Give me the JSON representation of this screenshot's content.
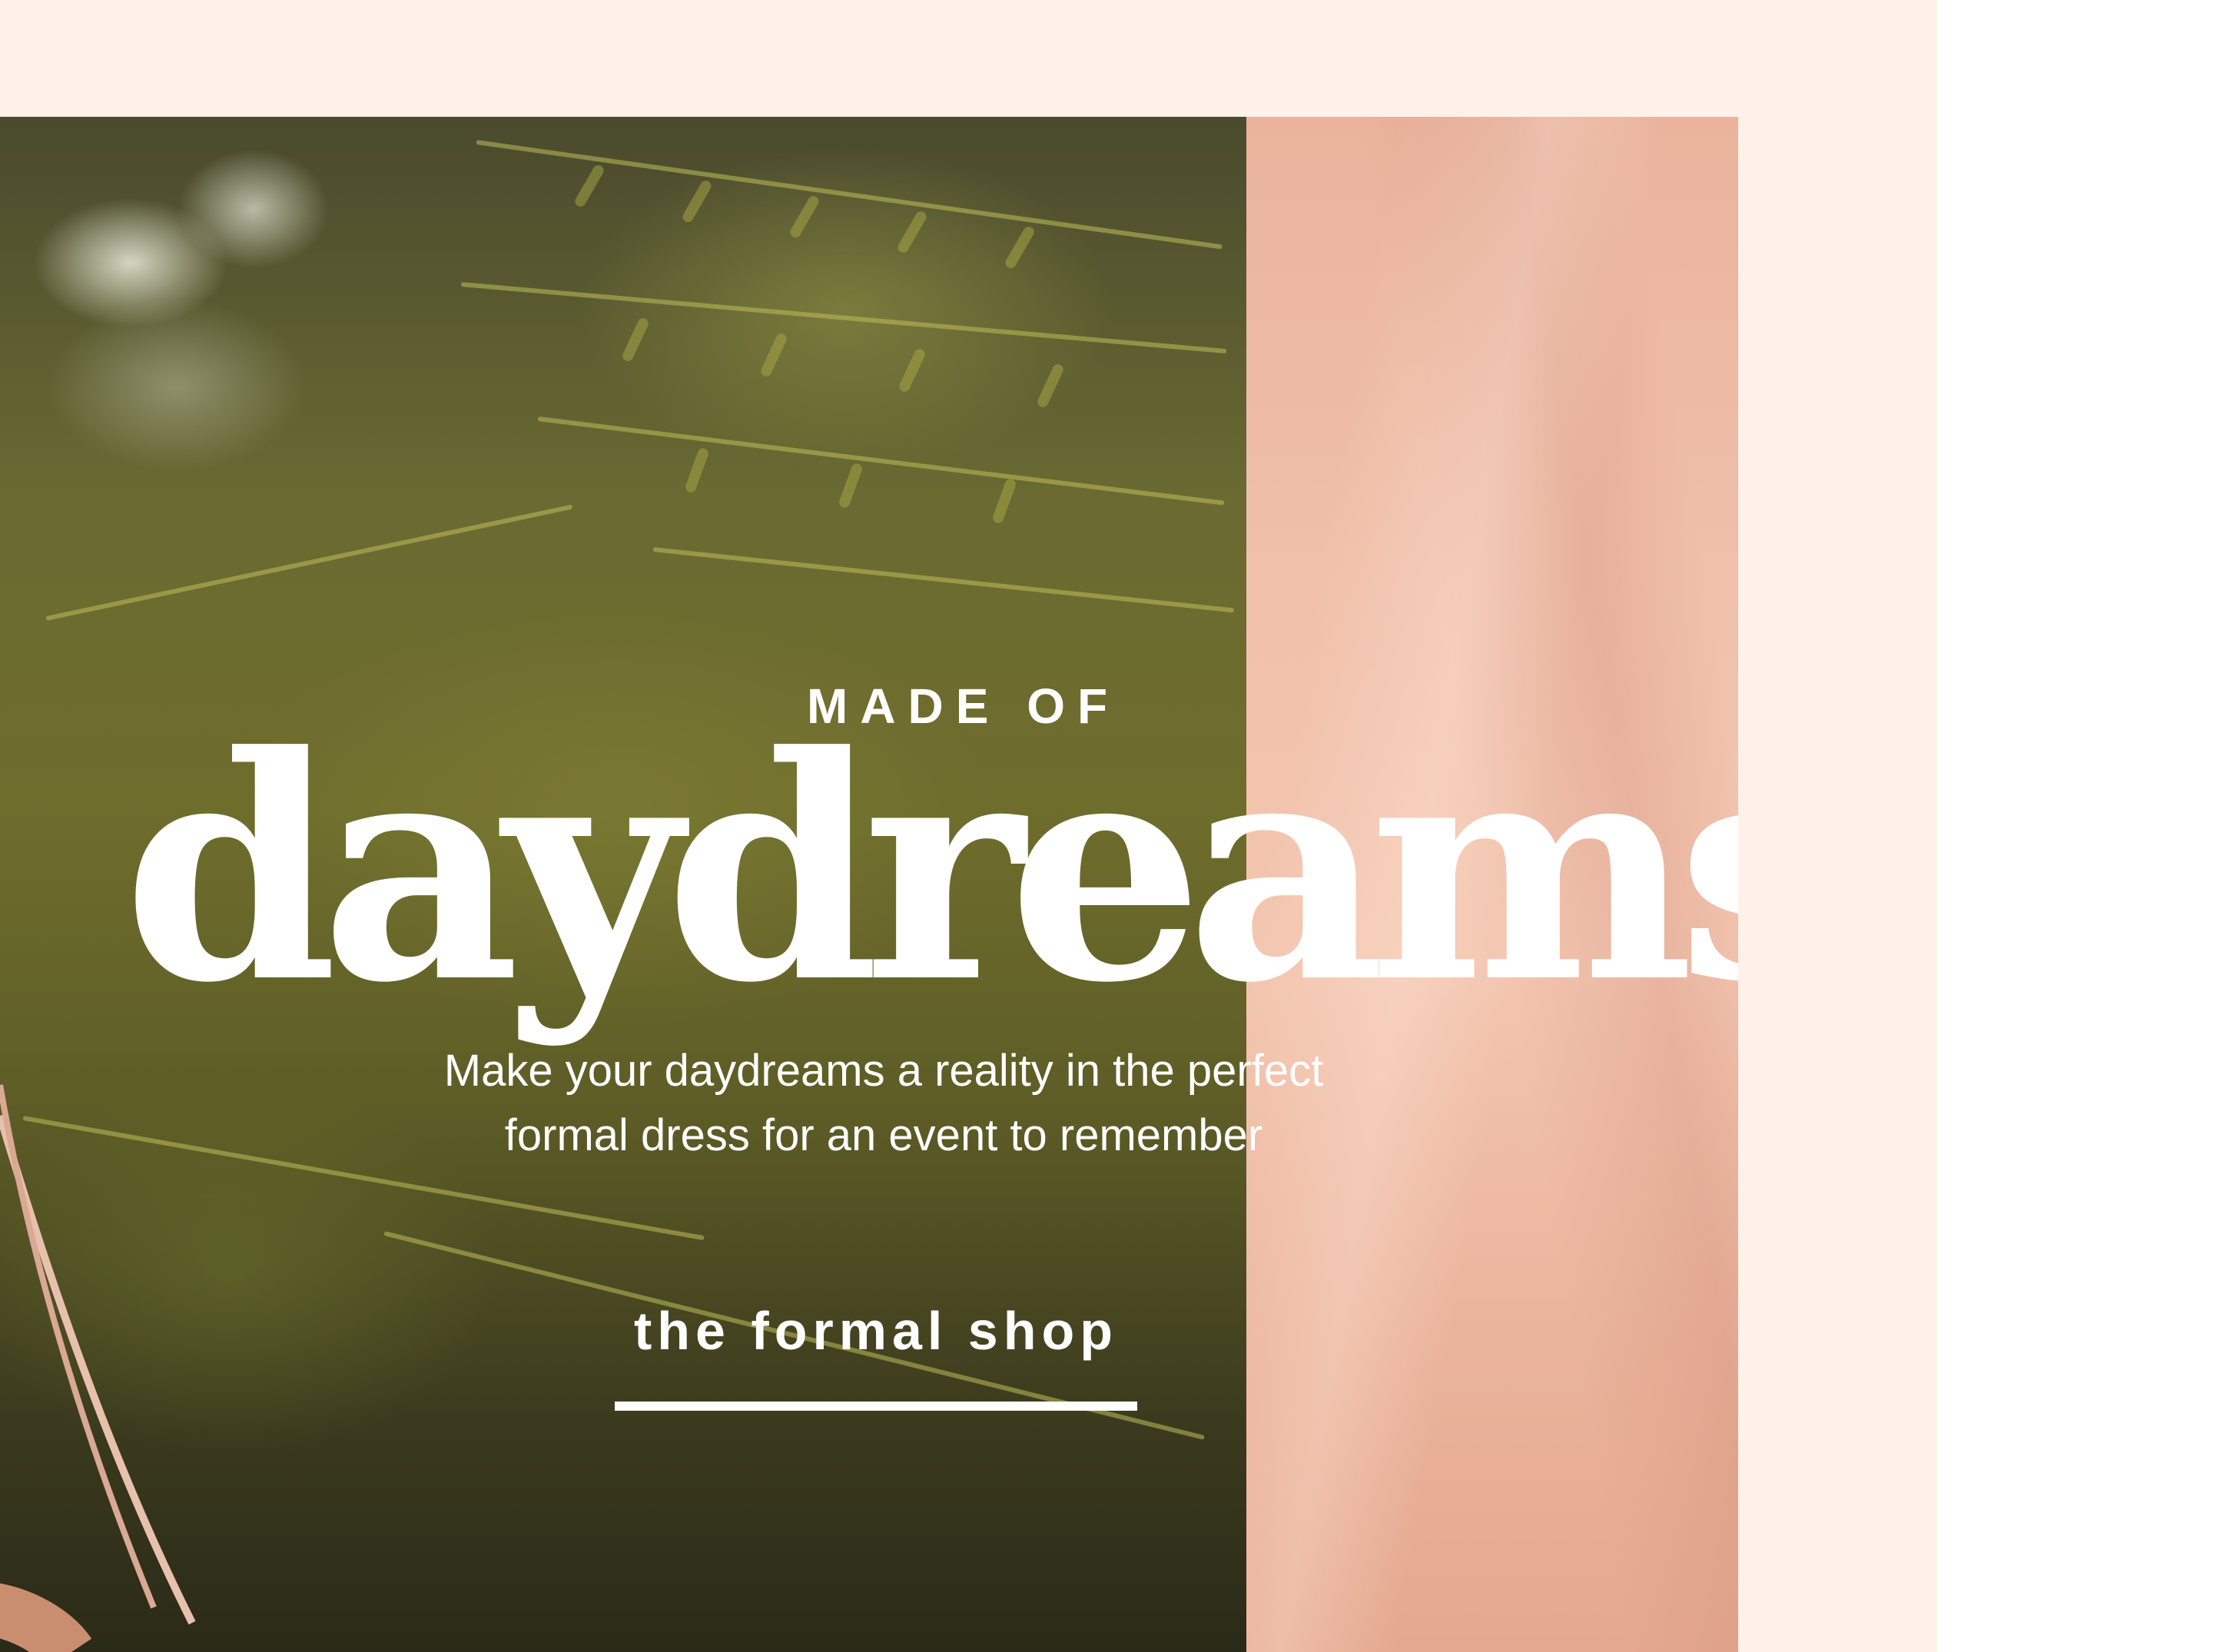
{
  "hero": {
    "eyebrow": "MADE OF",
    "headline": "daydreams",
    "subcopy_line1": "Make your daydreams a reality in the perfect",
    "subcopy_line2": "formal dress for an event to remember",
    "cta_label": "the formal shop"
  },
  "colors": {
    "page_background": "#fdf1ea",
    "fabric": "#f0c0aa",
    "foliage": "#6a6a32",
    "text": "#ffffff"
  }
}
